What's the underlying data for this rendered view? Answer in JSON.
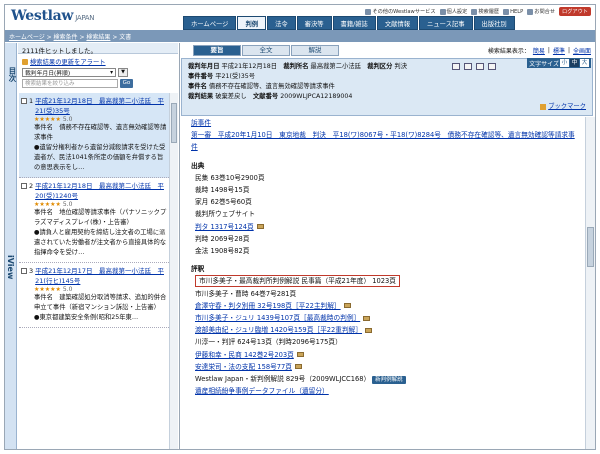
{
  "header": {
    "logo": "Westlaw",
    "logo_suffix": "JAPAN",
    "top_links": [
      "その他のWestlawサービス",
      "個人設定",
      "検索履歴",
      "HELP",
      "お問合せ",
      "ログアウト"
    ],
    "nav": [
      "ホームページ",
      "判例",
      "法令",
      "審決等",
      "書籍/雑誌",
      "文献情報",
      "ニュース記事",
      "出版社別"
    ],
    "active_nav": "判例",
    "breadcrumb": [
      "ホームページ",
      "検索条件",
      "検索結果",
      "文書"
    ]
  },
  "left": {
    "side_label_top": "目次",
    "side_label_bottom": "iView",
    "hits": "2111件ヒットしました。",
    "alert_link": "検索結果の更新をアラート",
    "sort_value": "裁判年月日(昇順)",
    "sort_btn": "▼",
    "search_placeholder": "検索結果を絞り込み",
    "go": "Go",
    "results": [
      {
        "num": "1",
        "title": "平成21年12月18日　最高裁第二小法廷　平21(受)35号",
        "stars": "★★★★★",
        "score": "5.0",
        "lines": [
          "事件名　債務不存在確認等、遺言無効確認等請求事件",
          "●遺留分権利者から遺留分減殺請求を受けた受遺者が、民法1041条所定の価額を弁償する旨の意思表示をし…"
        ]
      },
      {
        "num": "2",
        "title": "平成21年12月18日　最高裁第二小法廷　平20(受)1240号",
        "stars": "★★★★★",
        "score": "5.0",
        "lines": [
          "事件名　地位確認等請求事件（パナソニックプラズマディスプレイ(株)・上告審）",
          "●請負人と雇用契約を締結し注文者の工場に派遣されていた労働者が注文者から直接具体的な指揮命令を受け…"
        ]
      },
      {
        "num": "3",
        "title": "平成21年12月17日　最高裁第一小法廷　平21(行ヒ)145号",
        "stars": "★★★★★",
        "score": "5.0",
        "lines": [
          "事件名　建築確認処分取消等請求、追加的併合申立て事件（新宿マンション訴訟・上告審）",
          "●東京都建築安全条例(昭和25年東…"
        ]
      }
    ]
  },
  "right": {
    "tabs": [
      "要旨",
      "全文",
      "解説"
    ],
    "active_tab": "要旨",
    "display_size_label": "検索結果表示：",
    "display_sizes": [
      "簡易",
      "標準",
      "全画面"
    ],
    "font_size_label": "文字サイズ",
    "font_sizes": [
      "小",
      "中",
      "大"
    ],
    "info": {
      "date_label": "裁判年月日",
      "date": "平成21年12月18日",
      "court_label": "裁判所名",
      "court": "最高裁第二小法廷",
      "type_label": "裁判区分",
      "type": "判決",
      "case_no_label": "事件番号",
      "case_no": "平21(受)35号",
      "case_name_label": "事件名",
      "case_name": "債務不存在確認等、遺言無効確認等請求事件",
      "result_label": "裁判結果",
      "result": "破棄差戻し",
      "docno_label": "文献番号",
      "docno": "2009WLJPCA12189004",
      "bookmark": "ブックマーク"
    },
    "content": {
      "lines_top": [
        "訴事件",
        "第一審　平成20年1月10日　東京地裁　判決　平18(ワ)8067号・平18(ワ)8284号　債務不存在確認等、遺言無効確認等請求事件"
      ],
      "source_head": "出典",
      "sources": [
        "民集 63巻10号2900頁",
        "裁時 1498号15頁",
        "家月 62巻5号60頁",
        "裁判所ウェブサイト",
        "判タ 1317号124頁",
        "判時 2069号28頁",
        "金法 1908号82頁"
      ],
      "source_links": [
        false,
        false,
        false,
        false,
        true,
        false,
        false
      ],
      "review_head": "評釈",
      "reviews": [
        "市川多美子・最高裁判所判例解説 民事篇（平成21年度） 1023頁",
        "市川多美子・曹時 64巻7号281頁",
        "倉澤守春・判タ別冊 32号198頁［平22主判解］",
        "市川多美子・ジュリ 1439号107頁［最高裁時の判例］",
        "渡部美由紀・ジュリ臨増 1420号159頁［平22重判解］",
        "川淳一・判評 624号13頁（判時2096号175頁）",
        "伊藤和幸・民商 142巻2号203頁",
        "安達栄司・法の支配 158号77頁",
        "Westlaw Japan・新判例解説 829号（2009WLJCC168）",
        "遺産相続紛争事例データファイル（遺留分）"
      ],
      "review_links": [
        false,
        false,
        true,
        true,
        true,
        false,
        true,
        true,
        false,
        true
      ],
      "new_badge": "新判例解説"
    }
  }
}
